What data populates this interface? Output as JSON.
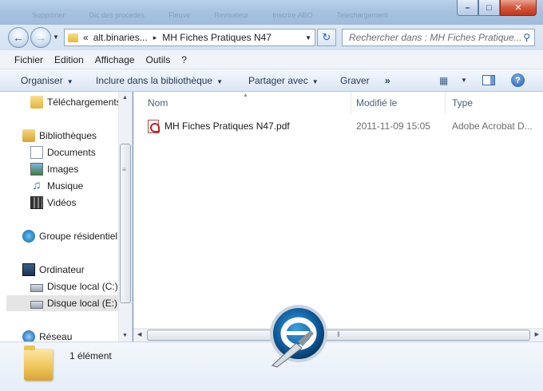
{
  "taskbar_ghost_labels": [
    "Supprimer",
    "Dic des procedes",
    "Fleuve",
    "Revisateur",
    "Inscrire ABO",
    "Telechargement"
  ],
  "window_buttons": {
    "minimize": "–",
    "maximize": "□",
    "close": "✕"
  },
  "address": {
    "overflow": "«",
    "segments": [
      "alt.binaries...",
      "MH Fiches Pratiques N47"
    ],
    "separator": "▸"
  },
  "search": {
    "placeholder": "Rechercher dans : MH Fiches Pratique..."
  },
  "menu": {
    "file": "Fichier",
    "edit": "Edition",
    "view": "Affichage",
    "tools": "Outils",
    "help": "?"
  },
  "toolbar": {
    "organize": "Organiser",
    "include": "Inclure dans la bibliothèque",
    "share": "Partager avec",
    "burn": "Graver",
    "more": "»",
    "help": "?"
  },
  "nav": {
    "downloads": "Téléchargements",
    "libraries": "Bibliothèques",
    "documents": "Documents",
    "images": "Images",
    "music": "Musique",
    "videos": "Vidéos",
    "homegroup": "Groupe résidentiel",
    "computer": "Ordinateur",
    "disk_c": "Disque local (C:)",
    "disk_e": "Disque local (E:)",
    "network": "Réseau"
  },
  "columns": {
    "name": "Nom",
    "modified": "Modifié le",
    "type": "Type"
  },
  "files": [
    {
      "name": "MH Fiches Pratiques N47.pdf",
      "modified": "2011-11-09 15:05",
      "type": "Adobe Acrobat D..."
    }
  ],
  "status": {
    "count": "1 élément"
  },
  "colors": {
    "accent": "#1e56a8",
    "selection": "#e5e5e5",
    "title_bar": "#b9d1ea"
  }
}
